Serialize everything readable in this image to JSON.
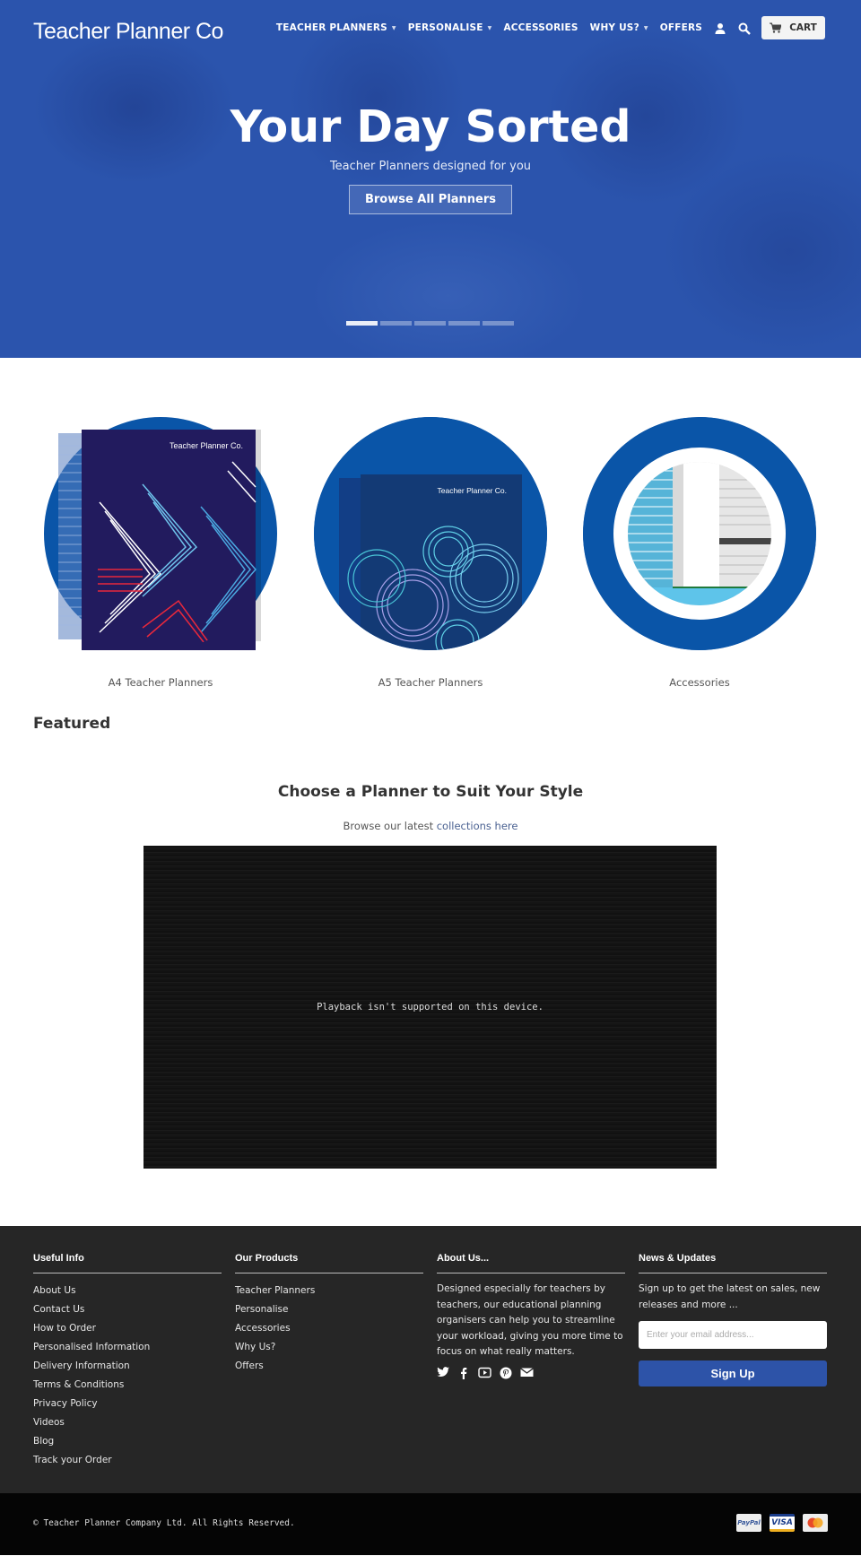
{
  "header": {
    "logo": "Teacher Planner Co",
    "nav": [
      {
        "label": "TEACHER PLANNERS",
        "has_dropdown": true
      },
      {
        "label": "PERSONALISE",
        "has_dropdown": true
      },
      {
        "label": "ACCESSORIES",
        "has_dropdown": false
      },
      {
        "label": "WHY US?",
        "has_dropdown": true
      },
      {
        "label": "OFFERS",
        "has_dropdown": false
      }
    ],
    "account_icon": "user-icon",
    "search_icon": "search-icon",
    "cart_label": "CART",
    "cart_icon": "cart-icon"
  },
  "hero": {
    "title": "Your Day Sorted",
    "subtitle": "Teacher Planners designed for you",
    "button_label": "Browse All Planners",
    "slides_total": 5,
    "active_slide": 1
  },
  "collections": [
    {
      "label": "A4 Teacher Planners",
      "cover_brand": "Teacher Planner Co."
    },
    {
      "label": "A5 Teacher Planners",
      "cover_brand": "Teacher Planner Co."
    },
    {
      "label": "Accessories"
    }
  ],
  "featured": {
    "heading": "Featured",
    "title": "Choose a Planner to Suit Your Style",
    "subtitle_prefix": "Browse our latest ",
    "subtitle_link": "collections here",
    "video_message": "Playback isn't supported on this device."
  },
  "footer": {
    "useful_info": {
      "heading": "Useful Info",
      "links": [
        "About Us",
        "Contact Us",
        "How to Order",
        "Personalised Information",
        "Delivery Information",
        "Terms & Conditions",
        "Privacy Policy",
        "Videos",
        "Blog",
        "Track your Order"
      ]
    },
    "our_products": {
      "heading": "Our Products",
      "links": [
        "Teacher Planners",
        "Personalise",
        "Accessories",
        "Why Us?",
        "Offers"
      ]
    },
    "about": {
      "heading": "About Us...",
      "text": "Designed especially for teachers by teachers, our educational planning organisers can help you to streamline your workload, giving you more time to focus on what really matters.",
      "social": [
        "twitter-icon",
        "facebook-icon",
        "youtube-icon",
        "pinterest-icon",
        "email-icon"
      ]
    },
    "news": {
      "heading": "News & Updates",
      "text": "Sign up to get the latest on sales, new releases and more ...",
      "email_placeholder": "Enter your email address...",
      "button_label": "Sign Up"
    },
    "copyright": "© Teacher Planner Company Ltd. All Rights Reserved.",
    "payments": [
      "PayPal",
      "VISA",
      "MasterCard"
    ]
  },
  "colors": {
    "hero_blue": "#2b54ad",
    "circle_blue": "#0a55a8",
    "footer_bg": "#262626",
    "signup_blue": "#2d53a8",
    "link_blue": "#4a6191"
  }
}
